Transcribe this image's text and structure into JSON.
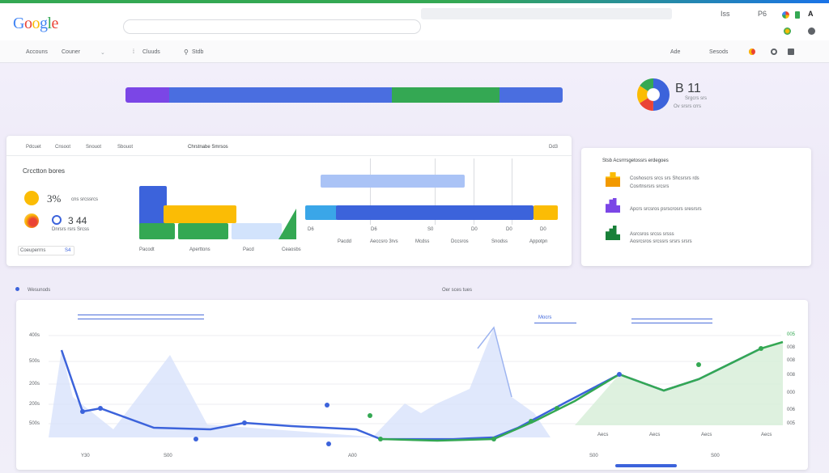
{
  "header": {
    "logo_letters": [
      "G",
      "o",
      "o",
      "g",
      "l",
      "e"
    ],
    "top_right": {
      "label_a": "Iss",
      "label_b": "P6",
      "label_c": "A"
    }
  },
  "navbar": {
    "items": [
      "Accouns",
      "Couner",
      "Cluuds",
      "Stdb"
    ],
    "right_items": [
      "Ade",
      "Sesods"
    ]
  },
  "overview": {
    "progress_segments": [
      {
        "color": "#7b46e6",
        "fraction": 0.1
      },
      {
        "color": "#4a6ee0",
        "fraction": 0.51
      },
      {
        "color": "#34a853",
        "fraction": 0.245
      },
      {
        "color": "#4a6ee0",
        "fraction": 0.145
      }
    ],
    "stat_value": "B 11",
    "stat_sub1": "Srgcrs srs",
    "stat_sub2": "Ov srsrs crrs"
  },
  "card1": {
    "tabs": [
      "Pdcuet",
      "Cnsoot",
      "Snouot",
      "Sbouot"
    ],
    "title": "Chrstnabe Smrsos",
    "corner": "Dd3",
    "section_title": "Crcctton bores",
    "kpi1_value": "3%",
    "kpi1_label": "cns srcssrcs",
    "kpi2_value": "3 44",
    "kpi2_label": "Dnrsrs rsrs Srcss",
    "footer_label": "Coeuperrns",
    "footer_value": "S4",
    "bar_labels": [
      "Pacodt",
      "Aperttons",
      "Pacd",
      "Ceaosbs"
    ],
    "right_values": [
      "D6",
      "D6",
      "S0",
      "D0",
      "D0",
      "D0"
    ],
    "right_labels": [
      "Pacdd",
      "Aeccsro 3rvs",
      "Mcdss",
      "Dccsros",
      "Snodss",
      "Appotpn"
    ]
  },
  "card2": {
    "title": "Stsb Acsrrrsgetossrs erdegoes",
    "rows": [
      {
        "line1": "Coshoscrs srcs srs Shcsrsrs rds",
        "line2": "Cosrtnsrsrs srcsrs"
      },
      {
        "line1": "Apcrs srcsros psrscrosrs sresrsrs",
        "line2": ""
      },
      {
        "line1": "Asrcsros srcss srsss",
        "line2": "Aosrcsros srcssrs srsrs srsrs"
      }
    ]
  },
  "card3": {
    "header_left": "Wesunods",
    "header_right": "Oer sces tues",
    "legend_label": "Mocrs",
    "y_ticks": [
      "400s",
      "500s",
      "200s",
      "200s",
      "500s"
    ],
    "right_ticks": [
      "005",
      "008",
      "008",
      "008",
      "000",
      "006",
      "005"
    ],
    "x_labels": [
      "Aecs",
      "Aecs",
      "Aecs",
      "Aecs"
    ],
    "bottom_labels": [
      "Y30",
      "S00",
      "A00",
      "S00",
      "S00"
    ]
  },
  "colors": {
    "blue": "#3c63db",
    "green": "#34a853",
    "yellow": "#fbbc05",
    "red": "#ea4335",
    "purple": "#7b46e6"
  }
}
